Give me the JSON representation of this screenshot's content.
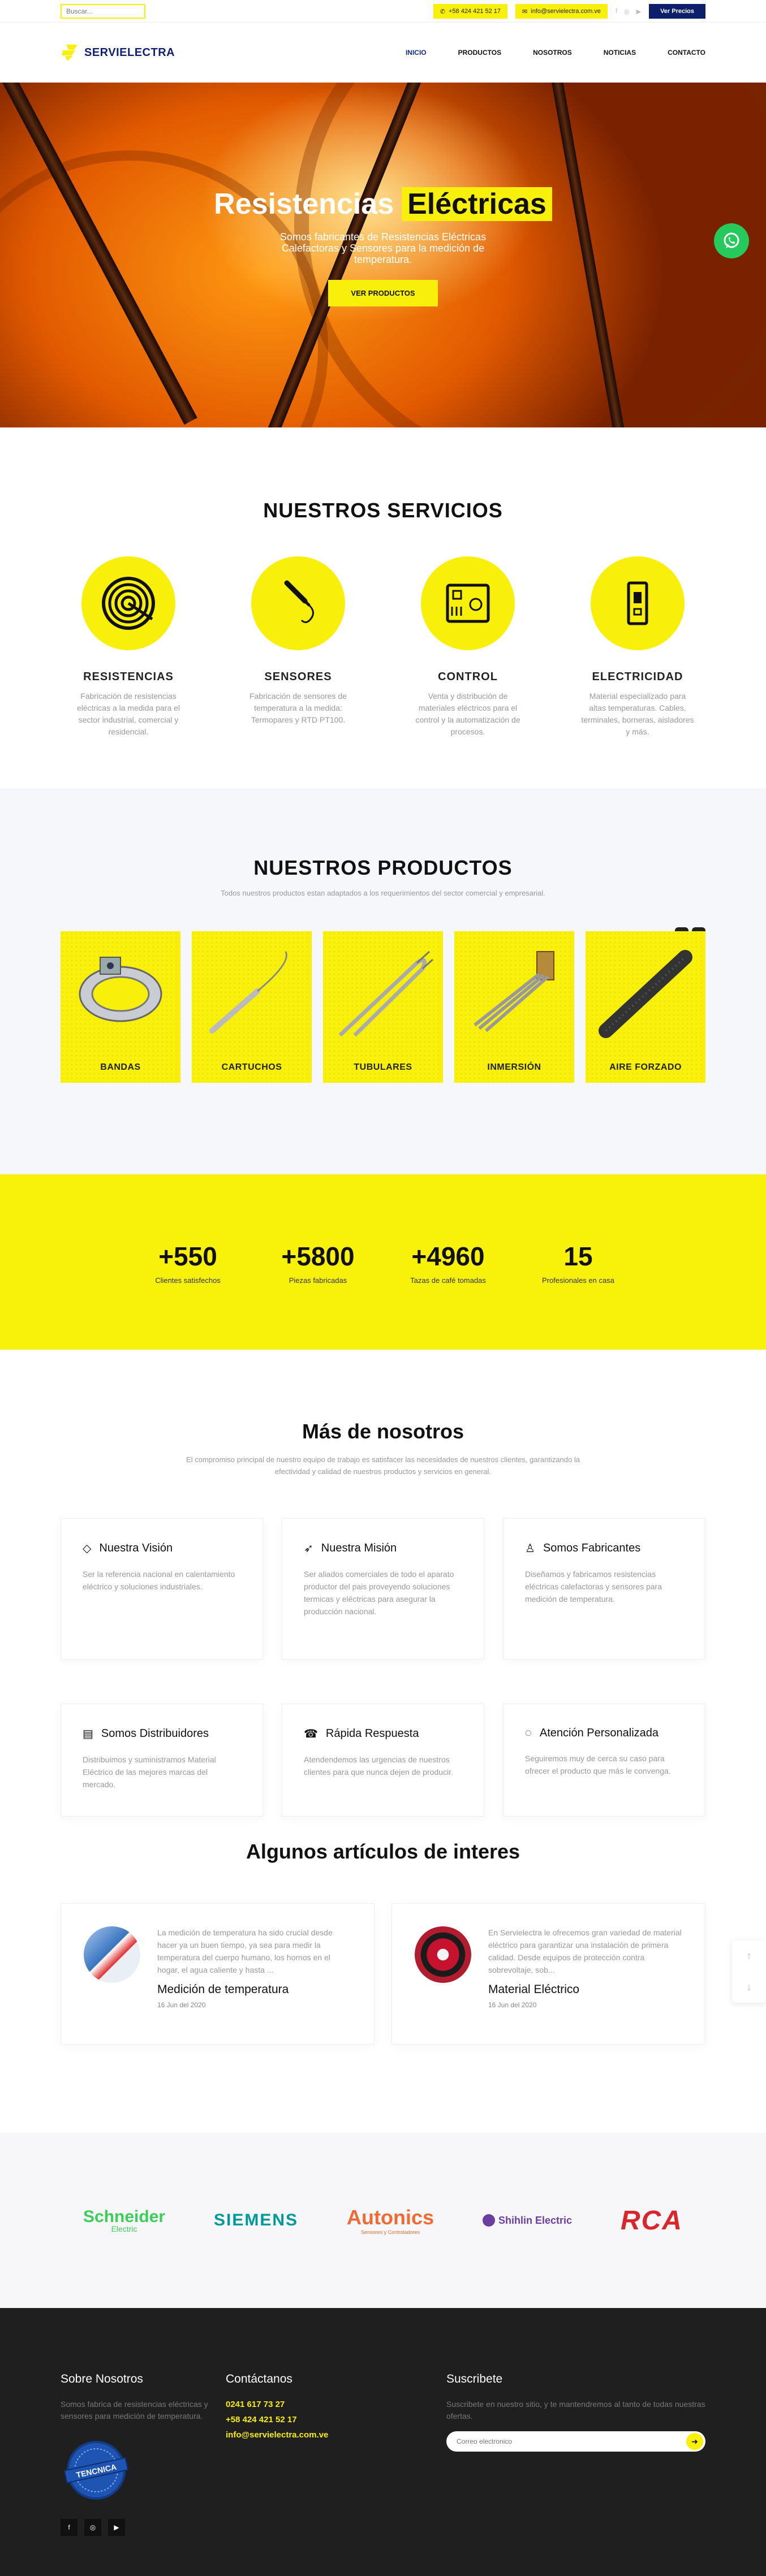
{
  "topbar": {
    "search_placeholder": "Buscar...",
    "phone": "+58 424 421 52 17",
    "email": "info@servielectra.com.ve",
    "prices_button": "Ver Precios"
  },
  "header": {
    "logo_text": "SERVIELECTRA",
    "nav": [
      "INICIO",
      "PRODUCTOS",
      "NOSOTROS",
      "NOTICIAS",
      "CONTACTO"
    ]
  },
  "hero": {
    "title_a": "Resistencias",
    "title_b": "Eléctricas",
    "subtitle": "Somos fabricantes de Resistencias Eléctricas Calefactoras y Sensores para la medición de temperatura.",
    "button": "VER PRODUCTOS"
  },
  "services": {
    "title": "NUESTROS SERVICIOS",
    "items": [
      {
        "title": "RESISTENCIAS",
        "text": "Fabricación de resistencias eléctricas a la medida para el sector industrial, comercial y residencial.",
        "icon": "coil-heater-icon"
      },
      {
        "title": "SENSORES",
        "text": "Fabricación de sensores de temperatura a la medida: Termopares y RTD PT100.",
        "icon": "thermocouple-sensor-icon"
      },
      {
        "title": "CONTROL",
        "text": "Venta y distribución de materiales eléctricos para el control y la automatización de procesos.",
        "icon": "control-unit-icon"
      },
      {
        "title": "ELECTRICIDAD",
        "text": "Material especializado para altas temperaturas. Cables, terminales, borneras, aisladores y más.",
        "icon": "switch-device-icon"
      }
    ]
  },
  "products": {
    "title": "NUESTROS PRODUCTOS",
    "subtitle": "Todos nuestros productos estan adaptados a los requerimientos del sector comercial y empresarial.",
    "items": [
      "BANDAS",
      "CARTUCHOS",
      "TUBULARES",
      "INMERSIÓN",
      "AIRE FORZADO"
    ]
  },
  "stats": [
    {
      "value": "+550",
      "label": "Clientes satisfechos"
    },
    {
      "value": "+5800",
      "label": "Piezas fabricadas"
    },
    {
      "value": "+4960",
      "label": "Tazas de café tomadas"
    },
    {
      "value": "15",
      "label": "Profesionales en casa"
    }
  ],
  "about": {
    "title": "Más de nosotros",
    "subtitle": "El compromiso principal de nuestro equipo de trabajo es satisfacer las necesidades de nuestros clientes, garantizando la efectividad y calidad de nuestros productos y servicios en general.",
    "cards": [
      {
        "title": "Nuestra Visión",
        "text": "Ser la referencia nacional en calentamiento eléctrico y soluciones industriales.",
        "icon": "diamond-icon"
      },
      {
        "title": "Nuestra Misión",
        "text": "Ser aliados comerciales de todo el aparato productor del pais proveyendo soluciones termicas y eléctricas para asegurar la producción nacional.",
        "icon": "rocket-icon"
      },
      {
        "title": "Somos Fabricantes",
        "text": "Diseñamos y fabricamos resistencias eléctricas calefactoras y sensores para medición de temperatura.",
        "icon": "user-icon"
      },
      {
        "title": "Somos Distribuidores",
        "text": "Distribuimos y suministramos Material Eléctrico de las mejores marcas del mercado.",
        "icon": "id-card-icon"
      },
      {
        "title": "Rápida Respuesta",
        "text": "Atendendemos las urgencias de nuestros clientes para que nunca dejen de producir.",
        "icon": "phone-icon"
      },
      {
        "title": "Atención Personalizada",
        "text": "Seguiremos muy de cerca su caso para ofrecer el producto que más le convenga.",
        "icon": "chat-icon"
      }
    ]
  },
  "articles": {
    "title": "Algunos artículos de interes",
    "items": [
      {
        "excerpt": "La medición de temperatura ha sido crucial desde hacer ya un buen tiempo, ya sea para medir la temperatura del cuerpo humano, los hornos en el hogar, el agua caliente y hasta ...",
        "title": "Medición de temperatura",
        "date": "16 Jun del 2020"
      },
      {
        "excerpt": "En Servielectra le ofrecemos gran variedad de material eléctrico para garantizar una instalación de primera calidad. Desde equipos de protección contra sobrevoltaje, sob...",
        "title": "Material Eléctrico",
        "date": "16 Jun del 2020"
      }
    ]
  },
  "brands": [
    {
      "name": "Schneider",
      "sub": "Electric",
      "color": "#3dcd58"
    },
    {
      "name": "SIEMENS",
      "color": "#009999"
    },
    {
      "name": "Autonics",
      "sub": "Sensores y Controladores",
      "color": "#ef6b33"
    },
    {
      "name": "Shihlin Electric",
      "color": "#6a3fa0"
    },
    {
      "name": "RCA",
      "color": "#d9262b"
    }
  ],
  "footer": {
    "about_title": "Sobre Nosotros",
    "about_text": "Somos fabrica de resistencias eléctricas y sensores para medición de temperatura.",
    "contact_title": "Contáctanos",
    "phone1": "0241 617 73 27",
    "phone2": "+58 424 421 52 17",
    "email": "info@servielectra.com.ve",
    "subscribe_title": "Suscribete",
    "subscribe_text": "Suscribete en nuestro sitio, y te mantendremos al tanto de todas nuestras ofertas.",
    "subscribe_placeholder": "Correo electronico",
    "seal_text": "TENCNICA",
    "social": [
      "facebook-icon",
      "instagram-icon",
      "youtube-icon"
    ]
  },
  "colors": {
    "brand_yellow": "#f8ef0b",
    "brand_navy": "#0d1e6b",
    "footer_bg": "#1f1f1f",
    "whatsapp": "#26c95b"
  }
}
